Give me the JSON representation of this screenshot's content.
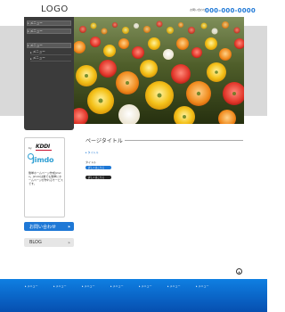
{
  "header": {
    "logo": "LOGO",
    "tagline": "",
    "phone_label": "お問い合わせ",
    "phone": "000-000-0000"
  },
  "nav": {
    "items": [
      {
        "label": "メニュー"
      },
      {
        "label": "メニュー"
      },
      {
        "label": "メニュー"
      },
      {
        "label": "メニュー"
      },
      {
        "label": "メニュー"
      }
    ]
  },
  "partner": {
    "by": "by",
    "kddi": "KDDI",
    "jimdo": "Jimdo",
    "description": "簡単ホームページ作成Jimdo。Jimdoは誰でも簡単にホームページが作れるサービスです。"
  },
  "sidebar": {
    "contact_label": "お問い合わせ",
    "blog_label": "BLOG"
  },
  "main": {
    "page_title": "ページタイトル",
    "link_text": "タイトル",
    "text": "タイトル",
    "tag1": "詳しくはこちら",
    "tag2": "詳しくはこちら"
  },
  "footer": {
    "credit": "",
    "links": [
      {
        "label": "メニュー"
      },
      {
        "label": "メニュー"
      },
      {
        "label": "メニュー"
      },
      {
        "label": "メニュー"
      },
      {
        "label": "メニュー"
      },
      {
        "label": "メニュー"
      },
      {
        "label": "メニュー"
      }
    ]
  },
  "colors": {
    "accent": "#1e78d6",
    "nav_bg": "#3b3b3b",
    "footer_top": "#0f7fe2",
    "footer_bottom": "#064fb0"
  },
  "icons": {
    "to_top": "arrow-up-icon",
    "arrow": "triangle-right-icon"
  }
}
